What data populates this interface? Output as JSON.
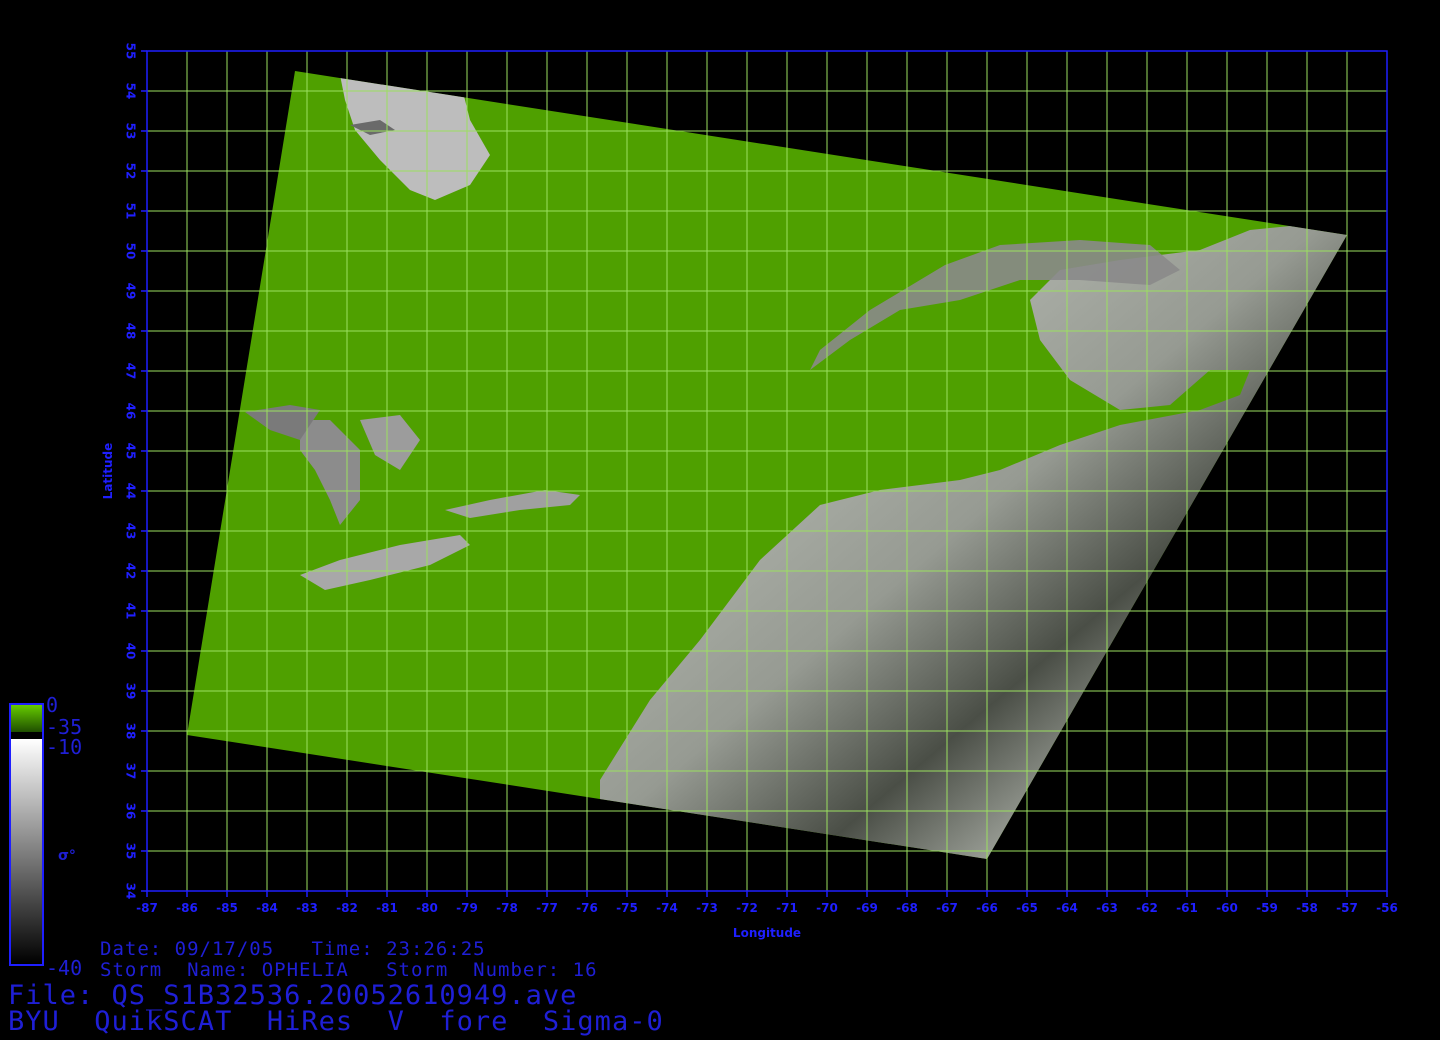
{
  "map": {
    "lon_range": [
      -87,
      -56
    ],
    "lat_range": [
      34,
      55
    ],
    "grid": true,
    "xlabel": "Longitude",
    "ylabel": "Latitude",
    "lon_ticks": [
      "-87",
      "-86",
      "-85",
      "-84",
      "-83",
      "-82",
      "-81",
      "-80",
      "-79",
      "-78",
      "-77",
      "-76",
      "-75",
      "-74",
      "-73",
      "-72",
      "-71",
      "-70",
      "-69",
      "-68",
      "-67",
      "-66",
      "-65",
      "-64",
      "-63",
      "-62",
      "-61",
      "-60",
      "-59",
      "-58",
      "-57",
      "-56"
    ],
    "lat_ticks": [
      "34",
      "35",
      "36",
      "37",
      "38",
      "39",
      "40",
      "41",
      "42",
      "43",
      "44",
      "45",
      "46",
      "47",
      "48",
      "49",
      "50",
      "51",
      "52",
      "53",
      "54",
      "55"
    ],
    "swath_corners_lonlat": [
      [
        -83.3,
        54.5
      ],
      [
        -57.0,
        50.4
      ],
      [
        -66.0,
        34.8
      ],
      [
        -86.0,
        37.9
      ]
    ],
    "colors": {
      "axis": "#1f1fff",
      "grid": "#9be060",
      "land": "#4fa000",
      "ocean_light": "#cfcfcf",
      "ocean_dark": "#2a2a2a"
    }
  },
  "colorbar": {
    "top_label": "0",
    "green_label": "-35",
    "gray_top_label": "-10",
    "bottom_label": "-40",
    "symbol": "σ°"
  },
  "info": {
    "date_line": "Date: 09/17/05   Time: 23:26:25",
    "storm_line": "Storm  Name: OPHELIA   Storm  Number: 16",
    "file_line": "File: QS_S1B32536.20052610949.ave",
    "product_line": "BYU  QuikSCAT  HiRes  V  fore  Sigma-0"
  }
}
